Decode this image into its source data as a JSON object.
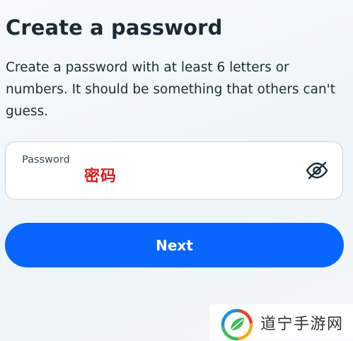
{
  "header": {
    "title": "Create a password",
    "subtitle": "Create a password with at least 6 letters or numbers. It should be something that others can't guess."
  },
  "password_field": {
    "label": "Password",
    "value": "密码",
    "visibility_icon": "eye-slash-icon"
  },
  "actions": {
    "next_label": "Next"
  },
  "watermark": {
    "text": "道宁手游网",
    "logo_icon": "leaf-swirl-logo"
  },
  "colors": {
    "primary_button": "#0866ff",
    "overlay_text": "#d42020",
    "text": "#1c2b33"
  }
}
